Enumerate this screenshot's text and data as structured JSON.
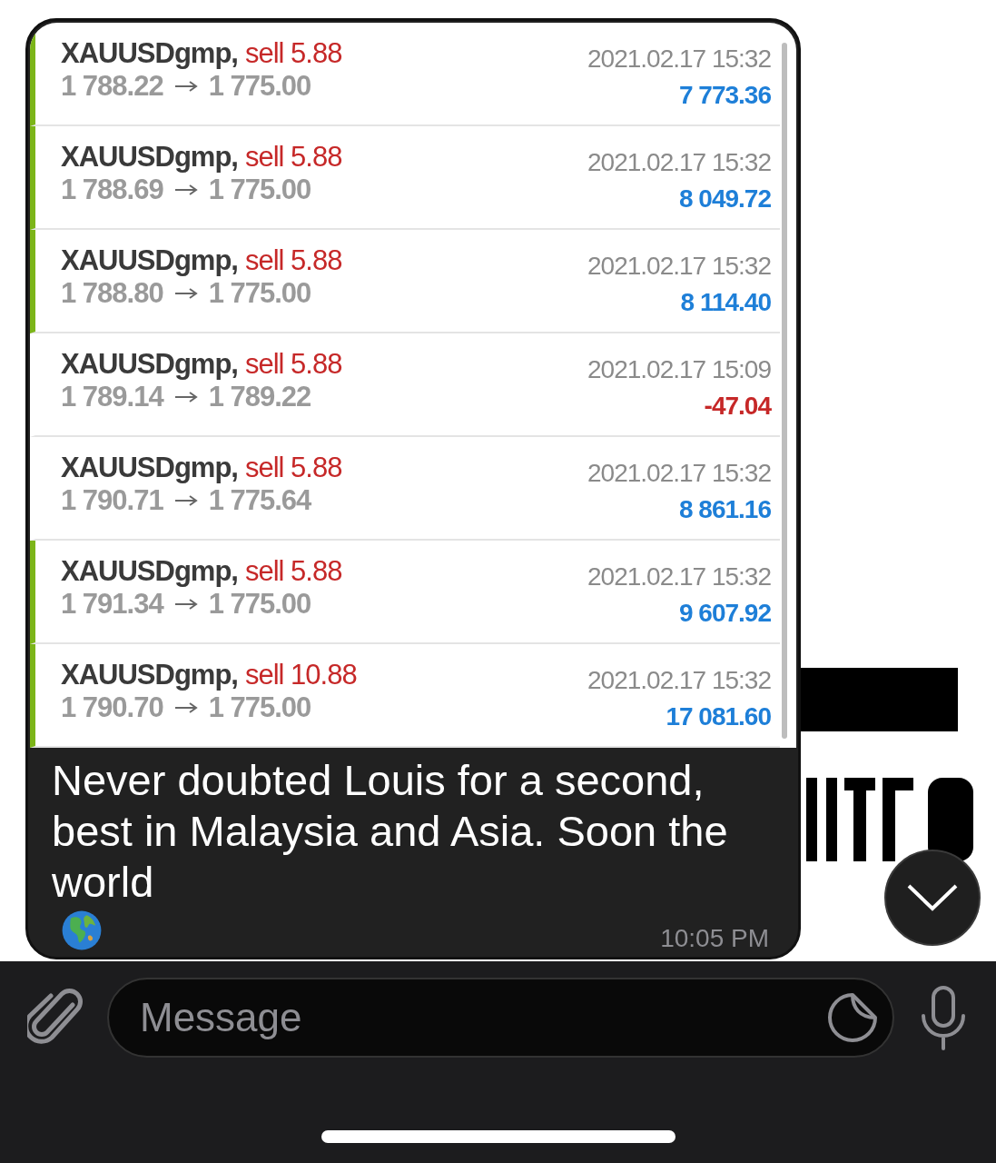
{
  "trades": [
    {
      "symbol": "XAUUSDgmp,",
      "side": "sell 5.88",
      "open": "1 788.22",
      "close": "1 775.00",
      "time": "2021.02.17 15:32",
      "profit": "7 773.36",
      "loss": false,
      "marked": true
    },
    {
      "symbol": "XAUUSDgmp,",
      "side": "sell 5.88",
      "open": "1 788.69",
      "close": "1 775.00",
      "time": "2021.02.17 15:32",
      "profit": "8 049.72",
      "loss": false,
      "marked": true
    },
    {
      "symbol": "XAUUSDgmp,",
      "side": "sell 5.88",
      "open": "1 788.80",
      "close": "1 775.00",
      "time": "2021.02.17 15:32",
      "profit": "8 114.40",
      "loss": false,
      "marked": true
    },
    {
      "symbol": "XAUUSDgmp,",
      "side": "sell 5.88",
      "open": "1 789.14",
      "close": "1 789.22",
      "time": "2021.02.17 15:09",
      "profit": "-47.04",
      "loss": true,
      "marked": false
    },
    {
      "symbol": "XAUUSDgmp,",
      "side": "sell 5.88",
      "open": "1 790.71",
      "close": "1 775.64",
      "time": "2021.02.17 15:32",
      "profit": "8 861.16",
      "loss": false,
      "marked": false
    },
    {
      "symbol": "XAUUSDgmp,",
      "side": "sell 5.88",
      "open": "1 791.34",
      "close": "1 775.00",
      "time": "2021.02.17 15:32",
      "profit": "9 607.92",
      "loss": false,
      "marked": true
    },
    {
      "symbol": "XAUUSDgmp,",
      "side": "sell 10.88",
      "open": "1 790.70",
      "close": "1 775.00",
      "time": "2021.02.17 15:32",
      "profit": "17 081.60",
      "loss": false,
      "marked": true
    }
  ],
  "message": {
    "text": "Never doubted Louis for a second, best in Malaysia and Asia. Soon the world",
    "time": "10:05 PM"
  },
  "composer": {
    "placeholder": "Message"
  }
}
